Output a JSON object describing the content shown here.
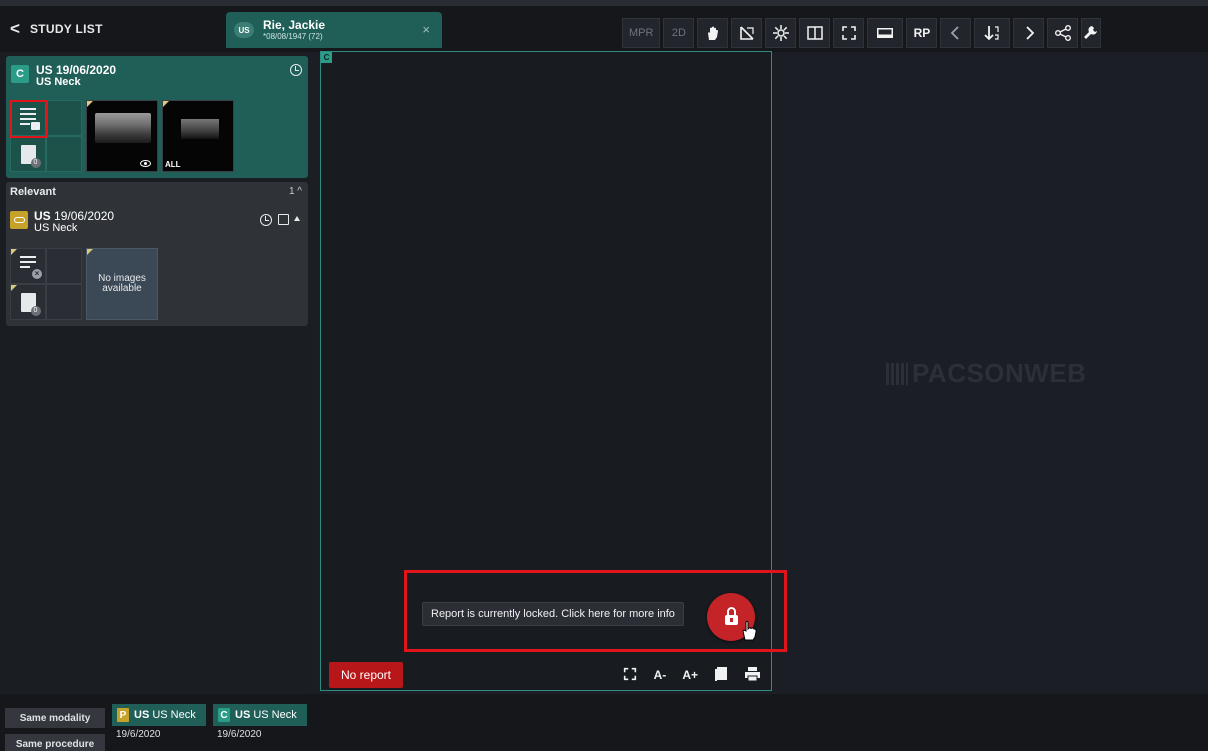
{
  "topbar": {
    "back_label": "STUDY LIST",
    "patient_tab": {
      "modality": "US",
      "name": "Rie, Jackie",
      "dob": "*08/08/1947 (72)",
      "close_glyph": "×"
    },
    "tools": {
      "mpr": "MPR",
      "twod": "2D",
      "rp": "RP"
    }
  },
  "current_study": {
    "badge": "C",
    "date_line": "US 19/06/2020",
    "description": "US Neck",
    "report_count": "0",
    "all_label": "ALL"
  },
  "relevant": {
    "heading": "Relevant",
    "count": "1",
    "study": {
      "modality": "US",
      "date": "19/06/2020",
      "description": "US Neck",
      "report_count": "0",
      "no_images": "No images available"
    }
  },
  "viewport": {
    "badge": "C",
    "no_report_label": "No report",
    "font_decrease": "A-",
    "font_increase": "A+",
    "lock_tooltip": "Report is currently locked. Click here for more info"
  },
  "watermark": "PACSONWEB",
  "bottombar": {
    "same_modality": "Same modality",
    "same_procedure": "Same procedure",
    "history": [
      {
        "letter": "P",
        "letter_color": "#c6a22b",
        "chip_color": "#1f5f57",
        "modality": "US",
        "description": "US Neck",
        "date": "19/6/2020"
      },
      {
        "letter": "C",
        "letter_color": "#2a9c88",
        "chip_color": "#1f5f57",
        "modality": "US",
        "description": "US Neck",
        "date": "19/6/2020"
      }
    ]
  },
  "colors": {
    "accent_teal": "#1f5f57",
    "alert_red": "#c42327",
    "background": "#1b1e24"
  }
}
